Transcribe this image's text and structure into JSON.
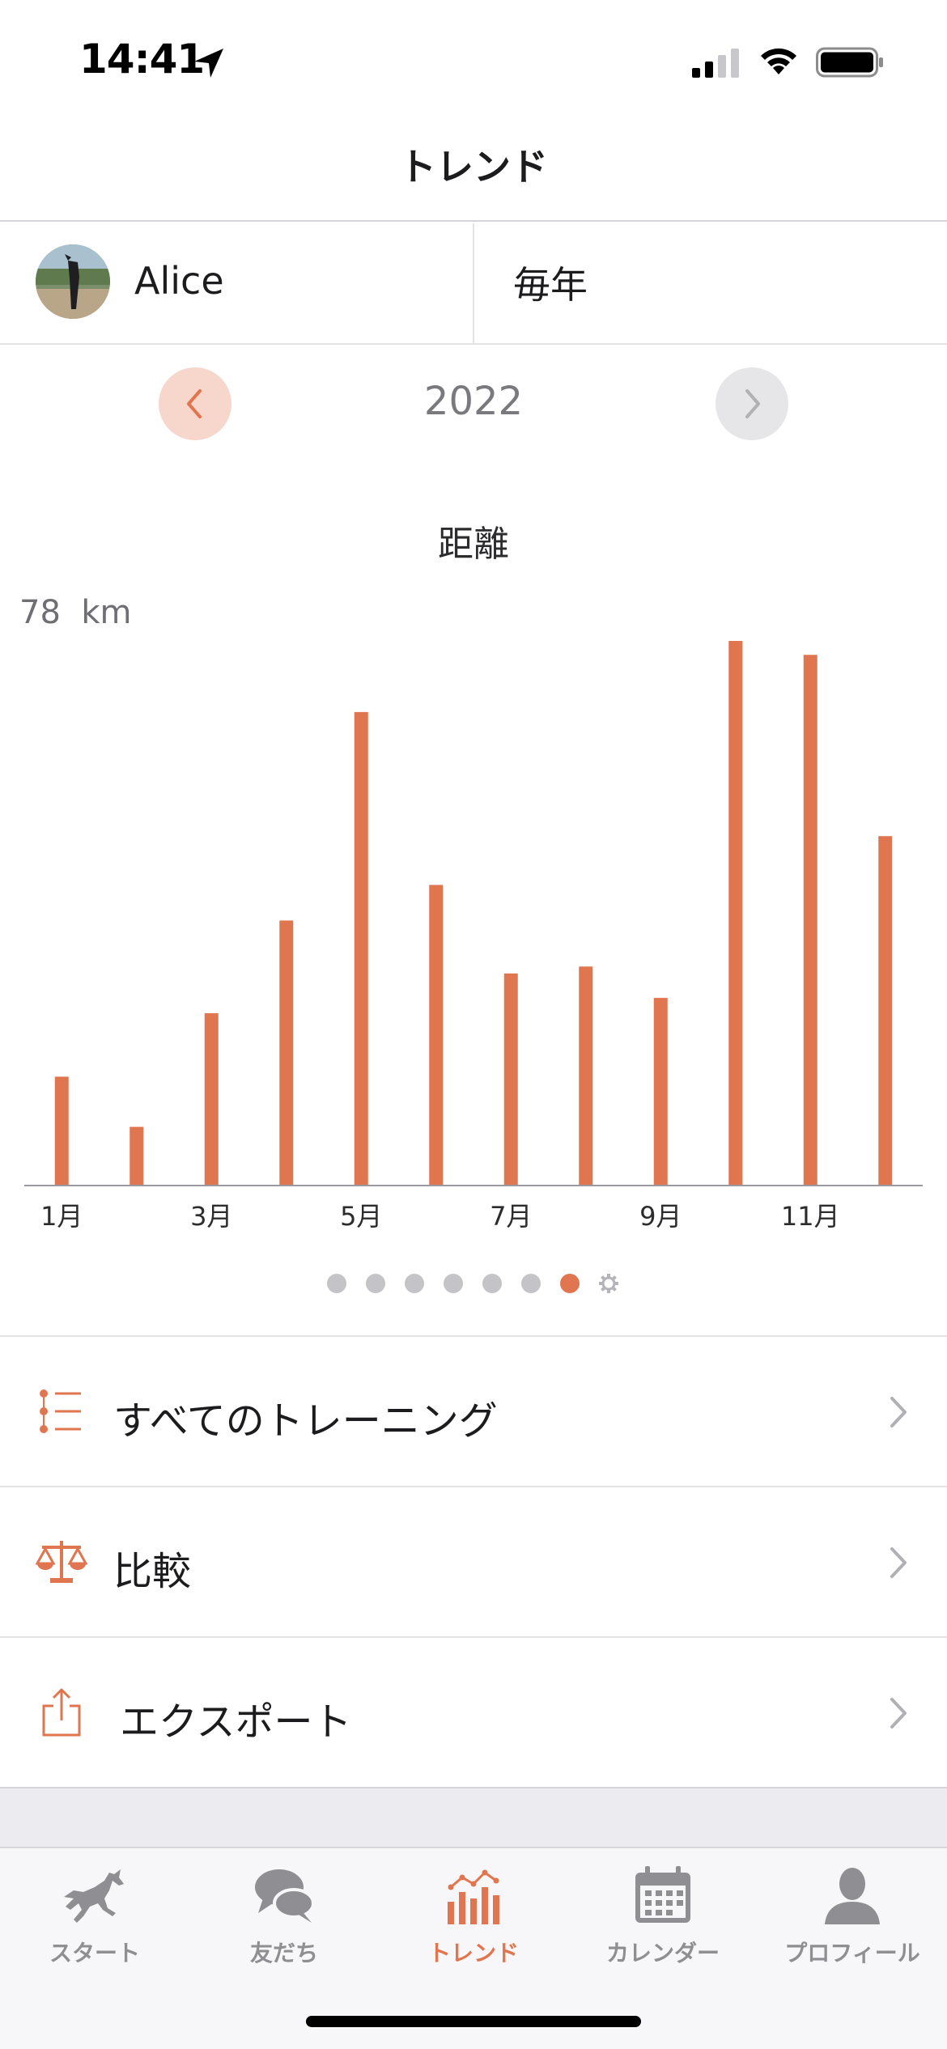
{
  "status_bar": {
    "time": "14:41",
    "icons": [
      "location-arrow-icon",
      "cellular-signal-icon",
      "wifi-icon",
      "battery-icon"
    ]
  },
  "header": {
    "title": "トレンド"
  },
  "selector": {
    "user_name": "Alice",
    "period": "毎年"
  },
  "year_nav": {
    "year": "2022"
  },
  "chart_data": {
    "type": "bar",
    "title": "距離",
    "max_label": "78",
    "unit": "km",
    "categories": [
      "1月",
      "2月",
      "3月",
      "4月",
      "5月",
      "6月",
      "7月",
      "8月",
      "9月",
      "10月",
      "11月",
      "12月"
    ],
    "tick_labels": [
      "1月",
      "3月",
      "5月",
      "7月",
      "9月",
      "11月"
    ],
    "values": [
      15.5,
      8.3,
      24.6,
      37.9,
      67.8,
      43.0,
      30.3,
      31.3,
      26.8,
      78.0,
      76.0,
      50.0
    ],
    "ylim": [
      0,
      78
    ],
    "bar_color": "#e07650",
    "grid": false
  },
  "pager": {
    "count": 7,
    "active_index": 6,
    "settings_icon": "gear-icon"
  },
  "menu": [
    {
      "label": "すべてのトレーニング",
      "icon": "list-icon"
    },
    {
      "label": "比較",
      "icon": "scales-icon"
    },
    {
      "label": "エクスポート",
      "icon": "share-icon"
    }
  ],
  "tabs": [
    {
      "label": "スタート",
      "icon": "horse-icon",
      "active": false
    },
    {
      "label": "友だち",
      "icon": "chat-bubbles-icon",
      "active": false
    },
    {
      "label": "トレンド",
      "icon": "bar-chart-icon",
      "active": true
    },
    {
      "label": "カレンダー",
      "icon": "calendar-icon",
      "active": false
    },
    {
      "label": "プロフィール",
      "icon": "person-icon",
      "active": false
    }
  ],
  "colors": {
    "accent": "#e07650",
    "inactive": "#8e8e93"
  }
}
